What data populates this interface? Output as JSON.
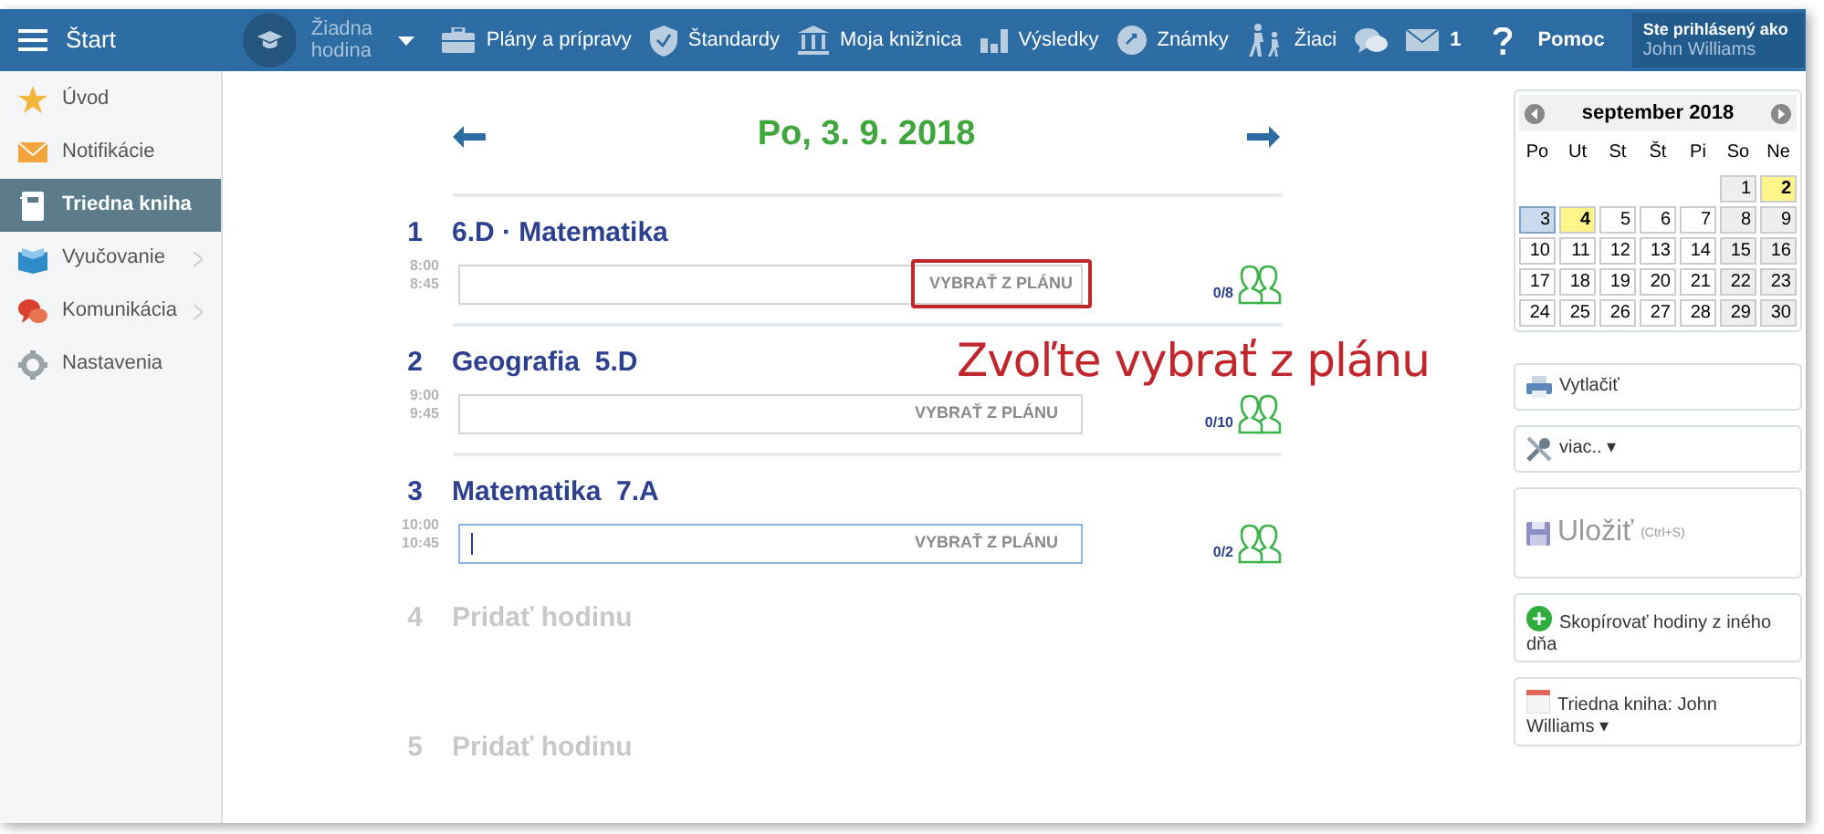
{
  "topbar": {
    "start": "Štart",
    "lesson_select": {
      "label": "Žiadna hodina"
    },
    "items": [
      {
        "kind": "briefcase",
        "label": "Plány a prípravy"
      },
      {
        "kind": "shield",
        "label": "Štandardy"
      },
      {
        "kind": "library",
        "label": "Moja knižnica"
      },
      {
        "kind": "bars",
        "label": "Výsledky"
      },
      {
        "kind": "grade",
        "label": "Známky"
      },
      {
        "kind": "pupils",
        "label": "Žiaci"
      },
      {
        "kind": "chat"
      },
      {
        "kind": "mail",
        "label": "1"
      },
      {
        "kind": "help",
        "label": "Pomoc"
      }
    ],
    "user": {
      "caption": "Ste prihlásený ako",
      "name": "John Williams"
    }
  },
  "sidebar": {
    "items": [
      {
        "kind": "star",
        "label": "Úvod",
        "selected": false,
        "expandable": false
      },
      {
        "kind": "envelope",
        "label": "Notifikácie",
        "selected": false,
        "expandable": false
      },
      {
        "kind": "notebook",
        "label": "Triedna kniha",
        "selected": true,
        "expandable": false
      },
      {
        "kind": "book",
        "label": "Vyučovanie",
        "selected": false,
        "expandable": true
      },
      {
        "kind": "bubbles",
        "label": "Komunikácia",
        "selected": false,
        "expandable": true
      },
      {
        "kind": "gear",
        "label": "Nastavenia",
        "selected": false,
        "expandable": false
      }
    ]
  },
  "day": {
    "title": "Po, 3. 9. 2018"
  },
  "lessons": [
    {
      "kind": "lesson",
      "number": "1",
      "start": "8:00",
      "end": "8:45",
      "title": "6.D · Matematika",
      "action": "VYBRAŤ Z PLÁNU",
      "highlighted": true,
      "focused": false,
      "count": "0/8"
    },
    {
      "kind": "lesson",
      "number": "2",
      "start": "9:00",
      "end": "9:45",
      "title": "Geografia  5.D",
      "action": "VYBRAŤ Z PLÁNU",
      "highlighted": false,
      "focused": false,
      "count": "0/10"
    },
    {
      "kind": "lesson",
      "number": "3",
      "start": "10:00",
      "end": "10:45",
      "title": "Matematika  7.A",
      "action": "VYBRAŤ Z PLÁNU",
      "highlighted": false,
      "focused": true,
      "count": "0/2"
    },
    {
      "kind": "empty",
      "number": "4",
      "title": "Pridať hodinu"
    },
    {
      "kind": "empty",
      "number": "5",
      "title": "Pridať hodinu"
    }
  ],
  "annotation": "Zvoľte vybrať z plánu",
  "calendar": {
    "month": "september 2018",
    "weekdays": [
      "Po",
      "Ut",
      "St",
      "Št",
      "Pi",
      "So",
      "Ne"
    ],
    "weeks": [
      [
        {
          "kind": "blank"
        },
        {
          "kind": "blank"
        },
        {
          "kind": "blank"
        },
        {
          "kind": "blank"
        },
        {
          "kind": "blank"
        },
        {
          "day": "1",
          "weekend": true,
          "marked": false,
          "selected": false
        },
        {
          "day": "2",
          "weekend": true,
          "marked": true,
          "selected": false
        }
      ],
      [
        {
          "day": "3",
          "weekend": false,
          "marked": false,
          "selected": true
        },
        {
          "day": "4",
          "weekend": false,
          "marked": true,
          "selected": false
        },
        {
          "day": "5",
          "weekend": false,
          "marked": false,
          "selected": false
        },
        {
          "day": "6",
          "weekend": false,
          "marked": false,
          "selected": false
        },
        {
          "day": "7",
          "weekend": false,
          "marked": false,
          "selected": false
        },
        {
          "day": "8",
          "weekend": true,
          "marked": false,
          "selected": false
        },
        {
          "day": "9",
          "weekend": true,
          "marked": false,
          "selected": false
        }
      ],
      [
        {
          "day": "10",
          "weekend": false,
          "marked": false,
          "selected": false
        },
        {
          "day": "11",
          "weekend": false,
          "marked": false,
          "selected": false
        },
        {
          "day": "12",
          "weekend": false,
          "marked": false,
          "selected": false
        },
        {
          "day": "13",
          "weekend": false,
          "marked": false,
          "selected": false
        },
        {
          "day": "14",
          "weekend": false,
          "marked": false,
          "selected": false
        },
        {
          "day": "15",
          "weekend": true,
          "marked": false,
          "selected": false
        },
        {
          "day": "16",
          "weekend": true,
          "marked": false,
          "selected": false
        }
      ],
      [
        {
          "day": "17",
          "weekend": false,
          "marked": false,
          "selected": false
        },
        {
          "day": "18",
          "weekend": false,
          "marked": false,
          "selected": false
        },
        {
          "day": "19",
          "weekend": false,
          "marked": false,
          "selected": false
        },
        {
          "day": "20",
          "weekend": false,
          "marked": false,
          "selected": false
        },
        {
          "day": "21",
          "weekend": false,
          "marked": false,
          "selected": false
        },
        {
          "day": "22",
          "weekend": true,
          "marked": false,
          "selected": false
        },
        {
          "day": "23",
          "weekend": true,
          "marked": false,
          "selected": false
        }
      ],
      [
        {
          "day": "24",
          "weekend": false,
          "marked": false,
          "selected": false
        },
        {
          "day": "25",
          "weekend": false,
          "marked": false,
          "selected": false
        },
        {
          "day": "26",
          "weekend": false,
          "marked": false,
          "selected": false
        },
        {
          "day": "27",
          "weekend": false,
          "marked": false,
          "selected": false
        },
        {
          "day": "28",
          "weekend": false,
          "marked": false,
          "selected": false
        },
        {
          "day": "29",
          "weekend": true,
          "marked": false,
          "selected": false
        },
        {
          "day": "30",
          "weekend": true,
          "marked": false,
          "selected": false
        }
      ]
    ]
  },
  "actions": [
    {
      "kind": "print",
      "label": "Vytlačiť"
    },
    {
      "kind": "more",
      "label": "viac.. ▾"
    },
    {
      "kind": "save",
      "label": "Uložiť",
      "hint": "(Ctrl+S)"
    },
    {
      "kind": "copy",
      "label": "Skopírovať hodiny z iného dňa"
    },
    {
      "kind": "owner",
      "label": "Triedna kniha: John Williams ▾"
    }
  ]
}
